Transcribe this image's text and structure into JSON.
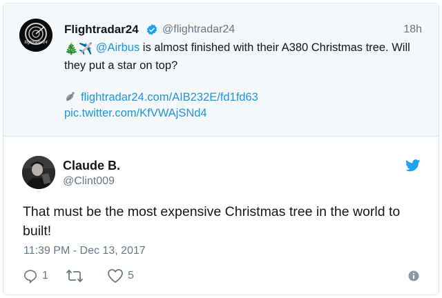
{
  "parent_tweet": {
    "display_name": "Flightradar24",
    "handle": "@flightradar24",
    "time": "18h",
    "text_emoji": "🎄✈️",
    "mention": "@Airbus",
    "text_rest": " is almost finished with their A380 Christmas tree. Will they put a star on top?",
    "link_url": "flightradar24.com/AIB232E/fd1fd63",
    "pic_url": "pic.twitter.com/KfVWAjSNd4",
    "avatar_text": "flightradar24"
  },
  "reply_tweet": {
    "display_name": "Claude B.",
    "handle": "@Clint009",
    "text": "That must be the most expensive Christmas tree in the world to built!",
    "timestamp": "11:39 PM - Dec 13, 2017",
    "reply_count": "1",
    "like_count": "5"
  },
  "colors": {
    "link": "#1b95e0",
    "muted": "#657786",
    "text": "#14171a",
    "parent_bg": "#f5f8fa"
  },
  "icons": [
    "verified-badge-icon",
    "satellite-dish-icon",
    "twitter-bird-icon",
    "reply-icon",
    "retweet-icon",
    "like-heart-icon",
    "info-icon"
  ]
}
